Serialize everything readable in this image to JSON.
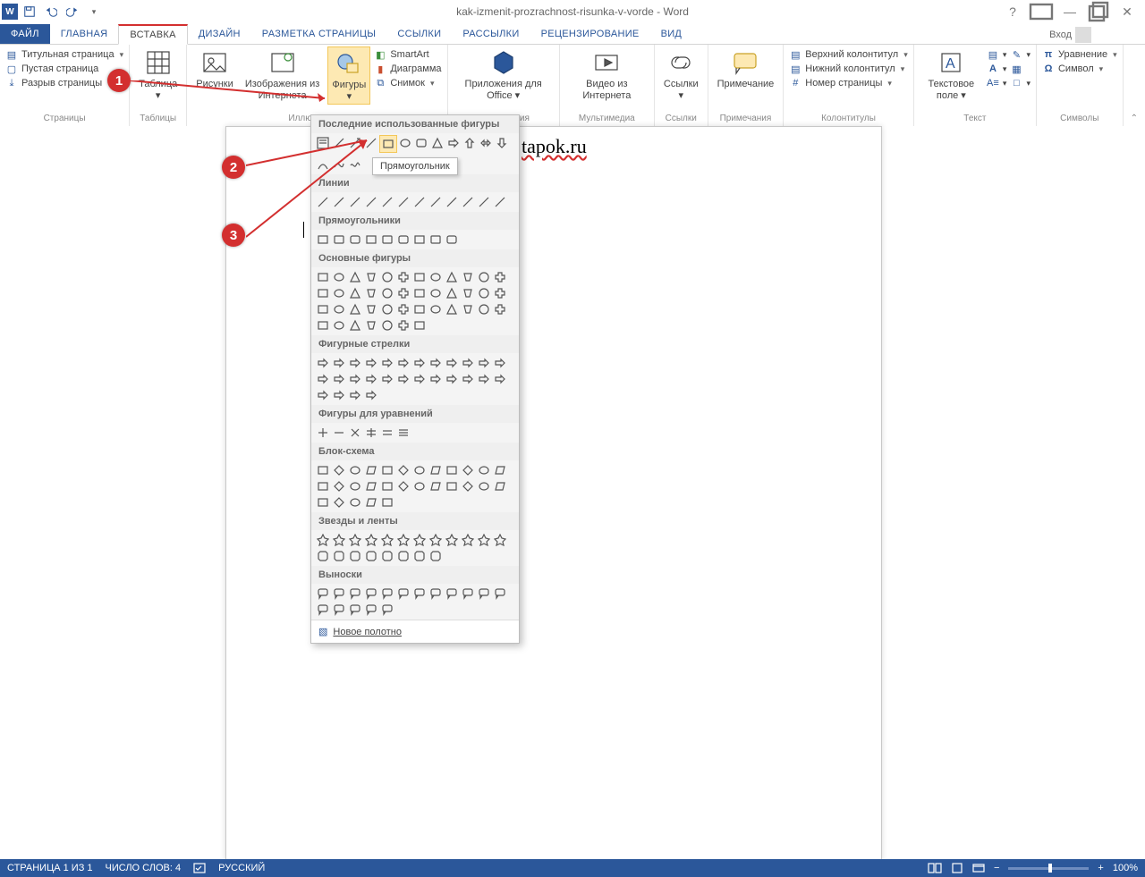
{
  "title": "kak-izmenit-prozrachnost-risunka-v-vorde - Word",
  "login": "Вход",
  "tabs": {
    "file": "ФАЙЛ",
    "home": "ГЛАВНАЯ",
    "insert": "ВСТАВКА",
    "design": "ДИЗАЙН",
    "layout": "РАЗМЕТКА СТРАНИЦЫ",
    "references": "ССЫЛКИ",
    "mailings": "РАССЫЛКИ",
    "review": "РЕЦЕНЗИРОВАНИЕ",
    "view": "ВИД"
  },
  "groups": {
    "pages": {
      "label": "Страницы",
      "title_page": "Титульная страница",
      "blank_page": "Пустая страница",
      "page_break": "Разрыв страницы"
    },
    "tables": {
      "label": "Таблицы",
      "table": "Таблица"
    },
    "illustrations": {
      "label": "Иллюстрации",
      "pictures": "Рисунки",
      "online_pictures": "Изображения из Интернета",
      "shapes": "Фигуры",
      "smartart": "SmartArt",
      "chart": "Диаграмма",
      "screenshot": "Снимок"
    },
    "apps": {
      "label": "Приложения",
      "apps_for_office": "Приложения для Office"
    },
    "media": {
      "label": "Мультимедиа",
      "online_video": "Видео из Интернета"
    },
    "links": {
      "label": "Ссылки",
      "links_btn": "Ссылки"
    },
    "comments": {
      "label": "Примечания",
      "comment": "Примечание"
    },
    "headers": {
      "label": "Колонтитулы",
      "header": "Верхний колонтитул",
      "footer": "Нижний колонтитул",
      "page_number": "Номер страницы"
    },
    "text": {
      "label": "Текст",
      "text_box": "Текстовое поле"
    },
    "symbols": {
      "label": "Символы",
      "equation": "Уравнение",
      "symbol": "Символ"
    }
  },
  "shapes_menu": {
    "recent": "Последние использованные фигуры",
    "lines": "Линии",
    "rectangles": "Прямоугольники",
    "basic": "Основные фигуры",
    "arrows": "Фигурные стрелки",
    "equation": "Фигуры для уравнений",
    "flowchart": "Блок-схема",
    "stars": "Звезды и ленты",
    "callouts": "Выноски",
    "new_canvas": "Новое полотно"
  },
  "tooltip": "Прямоугольник",
  "page_text_suffix": "tapok.ru",
  "callouts": {
    "c1": "1",
    "c2": "2",
    "c3": "3"
  },
  "status": {
    "page": "СТРАНИЦА 1 ИЗ 1",
    "words": "ЧИСЛО СЛОВ: 4",
    "lang": "РУССКИЙ",
    "zoom": "100%"
  }
}
